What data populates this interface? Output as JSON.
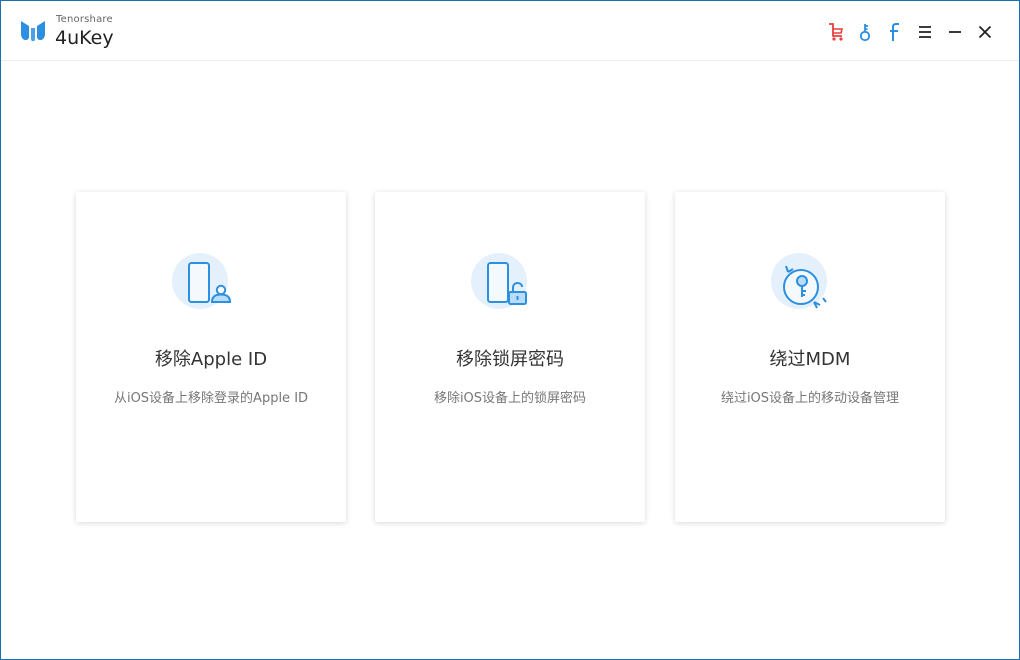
{
  "header": {
    "brand_small": "Tenorshare",
    "brand_name": "4uKey",
    "buttons": [
      {
        "name": "cart-icon"
      },
      {
        "name": "key-icon"
      },
      {
        "name": "facebook-icon"
      },
      {
        "name": "menu-icon"
      },
      {
        "name": "minimize-icon"
      },
      {
        "name": "close-icon"
      }
    ]
  },
  "colors": {
    "accent": "#2d8fe0",
    "cart": "#e8403f",
    "icon_bg": "#e4f1fc"
  },
  "cards": [
    {
      "title": "移除Apple ID",
      "desc": "从iOS设备上移除登录的Apple ID",
      "icon": "phone-user-icon"
    },
    {
      "title": "移除锁屏密码",
      "desc": "移除iOS设备上的锁屏密码",
      "icon": "phone-lock-icon"
    },
    {
      "title": "绕过MDM",
      "desc": "绕过iOS设备上的移动设备管理",
      "icon": "key-cycle-icon"
    }
  ]
}
